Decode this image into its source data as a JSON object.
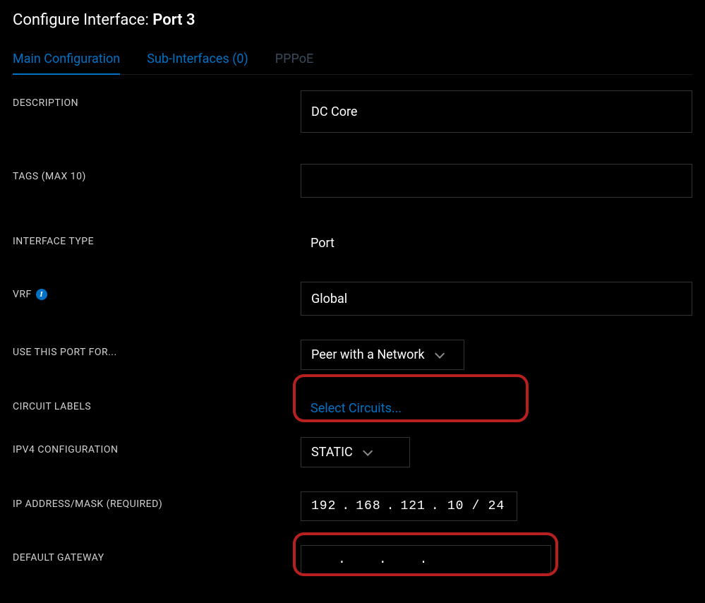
{
  "page": {
    "title_prefix": "Configure Interface: ",
    "title_bold": "Port 3"
  },
  "tabs": {
    "main": "Main Configuration",
    "sub": "Sub-Interfaces (0)",
    "pppoe": "PPPoE"
  },
  "labels": {
    "description": "DESCRIPTION",
    "tags": "TAGS (MAX 10)",
    "interface_type": "INTERFACE TYPE",
    "vrf": "VRF",
    "use_port": "USE THIS PORT FOR...",
    "circuit_labels": "CIRCUIT LABELS",
    "ipv4": "IPV4 CONFIGURATION",
    "ip_addr": "IP ADDRESS/MASK (REQUIRED)",
    "gateway": "DEFAULT GATEWAY"
  },
  "values": {
    "description": "DC Core",
    "tags": "",
    "interface_type": "Port",
    "vrf": "Global",
    "use_port": "Peer with a Network",
    "circuit_labels": "Select Circuits...",
    "ipv4": "STATIC",
    "ip": {
      "o1": "192",
      "o2": "168",
      "o3": "121",
      "o4": "10",
      "mask": "24"
    },
    "gateway": {
      "o1": "",
      "o2": "",
      "o3": "",
      "o4": ""
    }
  },
  "icons": {
    "info": "i"
  }
}
